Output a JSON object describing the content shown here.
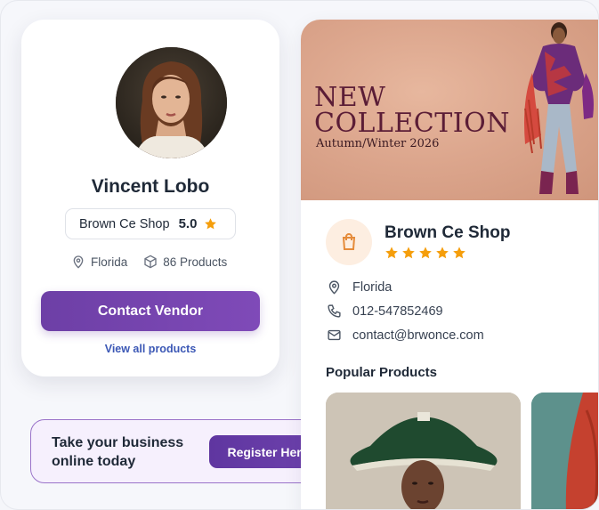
{
  "vendor": {
    "name": "Vincent Lobo",
    "shop_name": "Brown Ce Shop",
    "rating": "5.0",
    "location": "Florida",
    "products": "86 Products",
    "contact_label": "Contact Vendor",
    "view_all_label": "View all products"
  },
  "register": {
    "text": "Take your business online today",
    "button_label": "Register Here"
  },
  "shop": {
    "hero_title_line1": "NEW",
    "hero_title_line2": "COLLECTION",
    "hero_subtitle": "Autumn/Winter 2026",
    "name": "Brown Ce Shop",
    "stars": 5,
    "location": "Florida",
    "phone": "012-547852469",
    "email": "contact@brwonce.com",
    "popular_label": "Popular Products"
  },
  "colors": {
    "accent": "#6d3fa6",
    "star": "#f59e0b",
    "link": "#3b57b5",
    "hero_bg": "#dca68d",
    "hero_text": "#5b1d36"
  },
  "icons": [
    "map-pin-icon",
    "box-icon",
    "star-icon",
    "shopping-bag-icon",
    "phone-icon",
    "mail-icon"
  ]
}
